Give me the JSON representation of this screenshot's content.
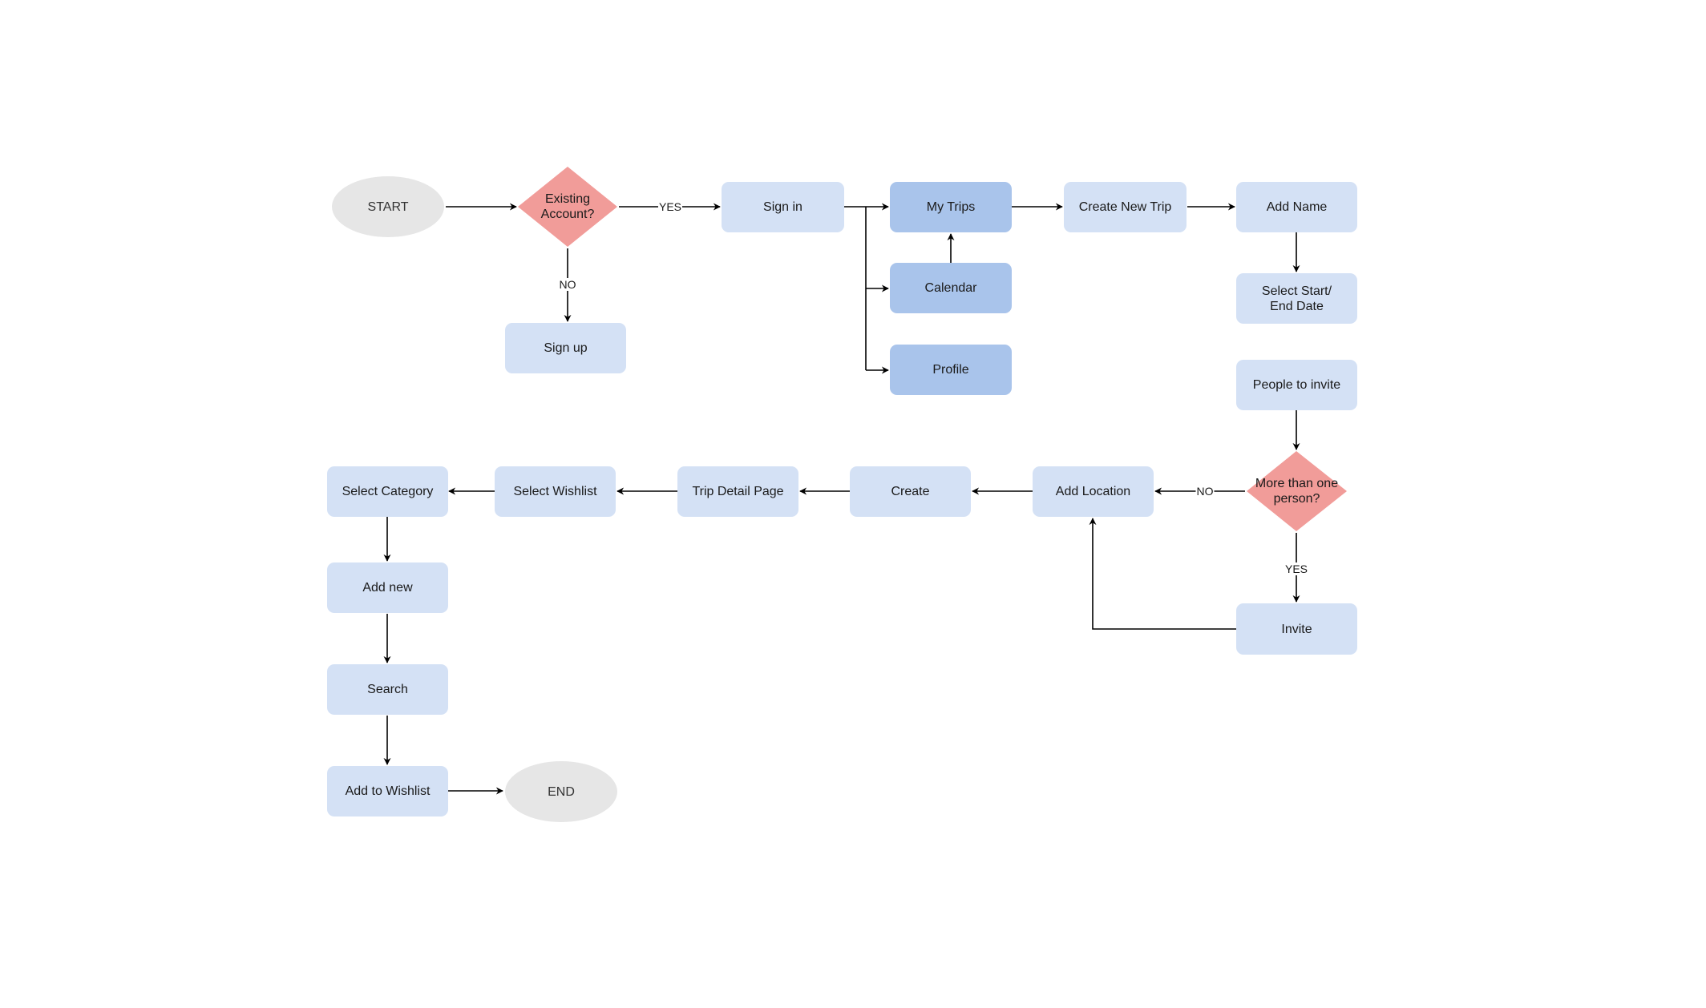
{
  "diagram": {
    "colors": {
      "process": "#d4e1f5",
      "process_highlight": "#a9c4eb",
      "decision": "#f19c99",
      "terminal": "#e6e6e6",
      "edge": "#000000"
    },
    "nodes": {
      "start": {
        "label": "START",
        "shape": "ellipse"
      },
      "existing_account": {
        "label": "Existing Account?",
        "line1": "Existing",
        "line2": "Account?",
        "shape": "diamond"
      },
      "sign_in": {
        "label": "Sign in",
        "shape": "rect"
      },
      "sign_up": {
        "label": "Sign up",
        "shape": "rect"
      },
      "my_trips": {
        "label": "My Trips",
        "shape": "rect"
      },
      "calendar": {
        "label": "Calendar",
        "shape": "rect"
      },
      "profile": {
        "label": "Profile",
        "shape": "rect"
      },
      "create_new_trip": {
        "label": "Create New Trip",
        "shape": "rect"
      },
      "add_name": {
        "label": "Add Name",
        "shape": "rect"
      },
      "select_dates": {
        "label": "Select Start/ End Date",
        "line1": "Select Start/",
        "line2": "End Date",
        "shape": "rect"
      },
      "people_to_invite": {
        "label": "People to invite",
        "shape": "rect"
      },
      "more_than_one": {
        "label": "More than one person?",
        "line1": "More than one",
        "line2": "person?",
        "shape": "diamond"
      },
      "invite": {
        "label": "Invite",
        "shape": "rect"
      },
      "add_location": {
        "label": "Add Location",
        "shape": "rect"
      },
      "create": {
        "label": "Create",
        "shape": "rect"
      },
      "trip_detail_page": {
        "label": "Trip Detail Page",
        "shape": "rect"
      },
      "select_wishlist": {
        "label": "Select Wishlist",
        "shape": "rect"
      },
      "select_category": {
        "label": "Select Category",
        "shape": "rect"
      },
      "add_new": {
        "label": "Add new",
        "shape": "rect"
      },
      "search": {
        "label": "Search",
        "shape": "rect"
      },
      "add_to_wishlist": {
        "label": "Add to Wishlist",
        "shape": "rect"
      },
      "end": {
        "label": "END",
        "shape": "ellipse"
      }
    },
    "edges": [
      {
        "from": "start",
        "to": "existing_account",
        "label": ""
      },
      {
        "from": "existing_account",
        "to": "sign_in",
        "label": "YES"
      },
      {
        "from": "existing_account",
        "to": "sign_up",
        "label": "NO"
      },
      {
        "from": "sign_in",
        "to": "my_trips",
        "label": ""
      },
      {
        "from": "sign_in",
        "to": "calendar",
        "label": ""
      },
      {
        "from": "sign_in",
        "to": "profile",
        "label": ""
      },
      {
        "from": "calendar",
        "to": "my_trips",
        "label": ""
      },
      {
        "from": "my_trips",
        "to": "create_new_trip",
        "label": ""
      },
      {
        "from": "create_new_trip",
        "to": "add_name",
        "label": ""
      },
      {
        "from": "add_name",
        "to": "select_dates",
        "label": ""
      },
      {
        "from": "people_to_invite",
        "to": "more_than_one",
        "label": ""
      },
      {
        "from": "more_than_one",
        "to": "add_location",
        "label": "NO"
      },
      {
        "from": "more_than_one",
        "to": "invite",
        "label": "YES"
      },
      {
        "from": "invite",
        "to": "add_location",
        "label": ""
      },
      {
        "from": "add_location",
        "to": "create",
        "label": ""
      },
      {
        "from": "create",
        "to": "trip_detail_page",
        "label": ""
      },
      {
        "from": "trip_detail_page",
        "to": "select_wishlist",
        "label": ""
      },
      {
        "from": "select_wishlist",
        "to": "select_category",
        "label": ""
      },
      {
        "from": "select_category",
        "to": "add_new",
        "label": ""
      },
      {
        "from": "add_new",
        "to": "search",
        "label": ""
      },
      {
        "from": "search",
        "to": "add_to_wishlist",
        "label": ""
      },
      {
        "from": "add_to_wishlist",
        "to": "end",
        "label": ""
      }
    ],
    "edge_labels": {
      "yes_account": "YES",
      "no_account": "NO",
      "no_person": "NO",
      "yes_person": "YES"
    }
  }
}
